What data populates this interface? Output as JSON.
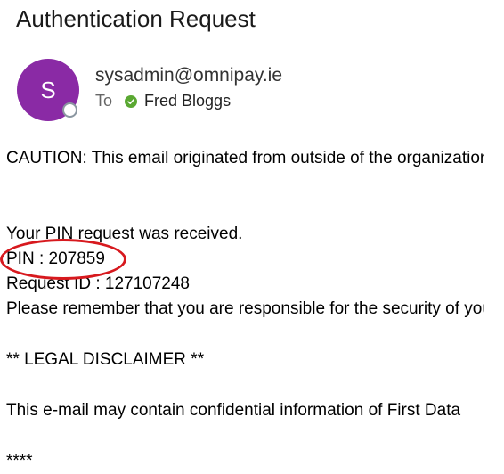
{
  "email": {
    "subject": "Authentication Request",
    "avatar_initial": "S",
    "sender": "sysadmin@omnipay.ie",
    "to_label": "To",
    "recipient": "Fred Bloggs"
  },
  "body": {
    "caution": "CAUTION: This email originated from outside of the organization.",
    "pin_request": "Your PIN request was received.",
    "pin_line": "PIN : 207859",
    "request_id_line": "Request ID : 127107248",
    "remember_line": "Please remember that you are responsible for the security of your PIN.",
    "legal_heading": "** LEGAL DISCLAIMER **",
    "disclaimer_line": "This e-mail may contain confidential information of First Data",
    "stars": "****"
  },
  "colors": {
    "avatar_bg": "#8a2aa5",
    "status_green": "#5aa832",
    "highlight_red": "#d7191e"
  },
  "icons": {
    "presence": "presence-status-icon",
    "verified": "verified-check-icon",
    "annotation": "red-ellipse-annotation"
  }
}
